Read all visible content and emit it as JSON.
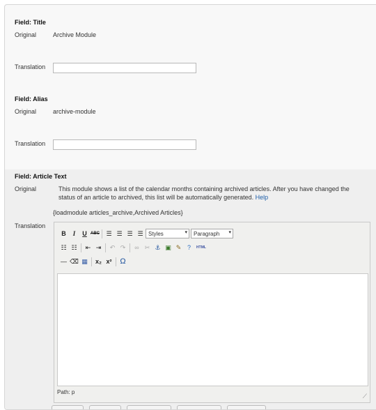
{
  "title_field": {
    "heading": "Field: Title",
    "original_label": "Original",
    "original_value": "Archive Module",
    "translation_label": "Translation",
    "translation_value": ""
  },
  "alias_field": {
    "heading": "Field: Alias",
    "original_label": "Original",
    "original_value": "archive-module",
    "translation_label": "Translation",
    "translation_value": ""
  },
  "article_field": {
    "heading": "Field: Article Text",
    "original_label": "Original",
    "original_text": "This module shows a list of the calendar months containing archived articles. After you have changed the status of an article to archived, this list will be automatically generated.",
    "help_link": "Help",
    "code_line": "{loadmodule articles_archive,Archived Articles}",
    "translation_label": "Translation"
  },
  "editor": {
    "styles_select": "Styles",
    "format_select": "Paragraph",
    "toolbar_row1": [
      "B",
      "I",
      "U",
      "ABC"
    ],
    "path_label": "Path: p",
    "html_button": "HTML",
    "sub_label": "x₂",
    "sup_label": "x²",
    "omega_label": "Ω"
  }
}
